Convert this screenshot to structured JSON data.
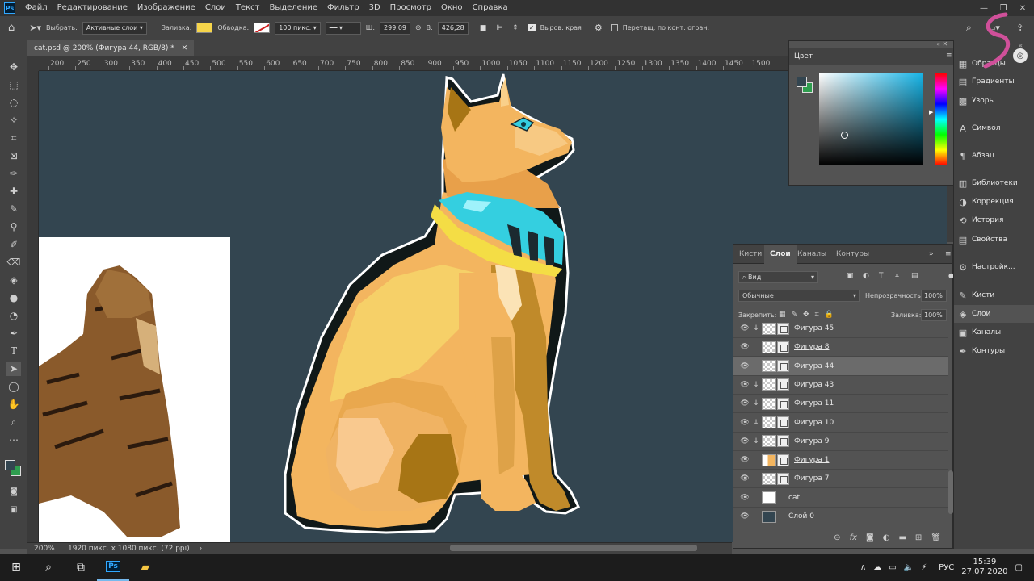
{
  "app": {
    "logo": "Ps"
  },
  "menu": [
    "Файл",
    "Редактирование",
    "Изображение",
    "Слои",
    "Текст",
    "Выделение",
    "Фильтр",
    "3D",
    "Просмотр",
    "Окно",
    "Справка"
  ],
  "options": {
    "select_label": "Выбрать:",
    "select_value": "Активные слои",
    "fill_label": "Заливка:",
    "stroke_label": "Обводка:",
    "stroke_size": "100 пикс.",
    "w_label": "Ш:",
    "w_value": "299,09",
    "h_label": "В:",
    "h_value": "426,28",
    "align_edges": "Выров. края",
    "constrain": "Перетащ. по конт. огран.",
    "fill_color": "#f6d54a"
  },
  "document": {
    "tab_title": "cat.psd @ 200% (Фигура 44, RGB/8) *"
  },
  "ruler": [
    "200",
    "250",
    "300",
    "350",
    "400",
    "450",
    "500",
    "550",
    "600",
    "650",
    "700",
    "750",
    "800",
    "850",
    "900",
    "950",
    "1000",
    "1050",
    "1100",
    "1150",
    "1200",
    "1250",
    "1300",
    "1350",
    "1400",
    "1450",
    "1500"
  ],
  "status": {
    "zoom": "200%",
    "doc_info": "1920 пикс. x 1080 пикс. (72 ppi)"
  },
  "color_panel": {
    "tab": "Цвет"
  },
  "layers_panel": {
    "tabs": [
      "Кисти",
      "Слои",
      "Каналы",
      "Контуры"
    ],
    "filter_label": "Вид",
    "blend_mode": "Обычные",
    "opacity_label": "Непрозрачность:",
    "opacity_value": "100%",
    "lock_label": "Закрепить:",
    "fill_label": "Заливка:",
    "fill_value": "100%",
    "layers": [
      {
        "name": "Фигура 45",
        "clip": true,
        "underline": false,
        "selected": false
      },
      {
        "name": "Фигура 8",
        "clip": false,
        "underline": true,
        "selected": false
      },
      {
        "name": "Фигура 44",
        "clip": false,
        "underline": false,
        "selected": true
      },
      {
        "name": "Фигура 43",
        "clip": true,
        "underline": false,
        "selected": false
      },
      {
        "name": "Фигура 11",
        "clip": true,
        "underline": false,
        "selected": false
      },
      {
        "name": "Фигура 10",
        "clip": true,
        "underline": false,
        "selected": false
      },
      {
        "name": "Фигура 9",
        "clip": true,
        "underline": false,
        "selected": false
      },
      {
        "name": "Фигура 1",
        "clip": false,
        "underline": true,
        "selected": false
      },
      {
        "name": "Фигура 7",
        "clip": false,
        "underline": false,
        "selected": false
      },
      {
        "name": "cat",
        "clip": false,
        "underline": false,
        "selected": false
      },
      {
        "name": "Слой 0",
        "clip": false,
        "underline": false,
        "selected": false
      }
    ]
  },
  "dock": {
    "items": [
      "Образцы",
      "Градиенты",
      "Узоры",
      "Символ",
      "Абзац",
      "Библиотеки",
      "Коррекция",
      "История",
      "Свойства",
      "Настройк...",
      "Кисти",
      "Слои",
      "Каналы",
      "Контуры"
    ],
    "active": "Слои"
  },
  "taskbar": {
    "lang": "РУС",
    "time": "15:39",
    "date": "27.07.2020"
  },
  "colors": {
    "canvas_bg": "#334550",
    "cat_body": "#f3b55f",
    "cat_shadow": "#c98f2e",
    "collar": "#34cfe0",
    "collar_gold": "#f4dd45"
  }
}
